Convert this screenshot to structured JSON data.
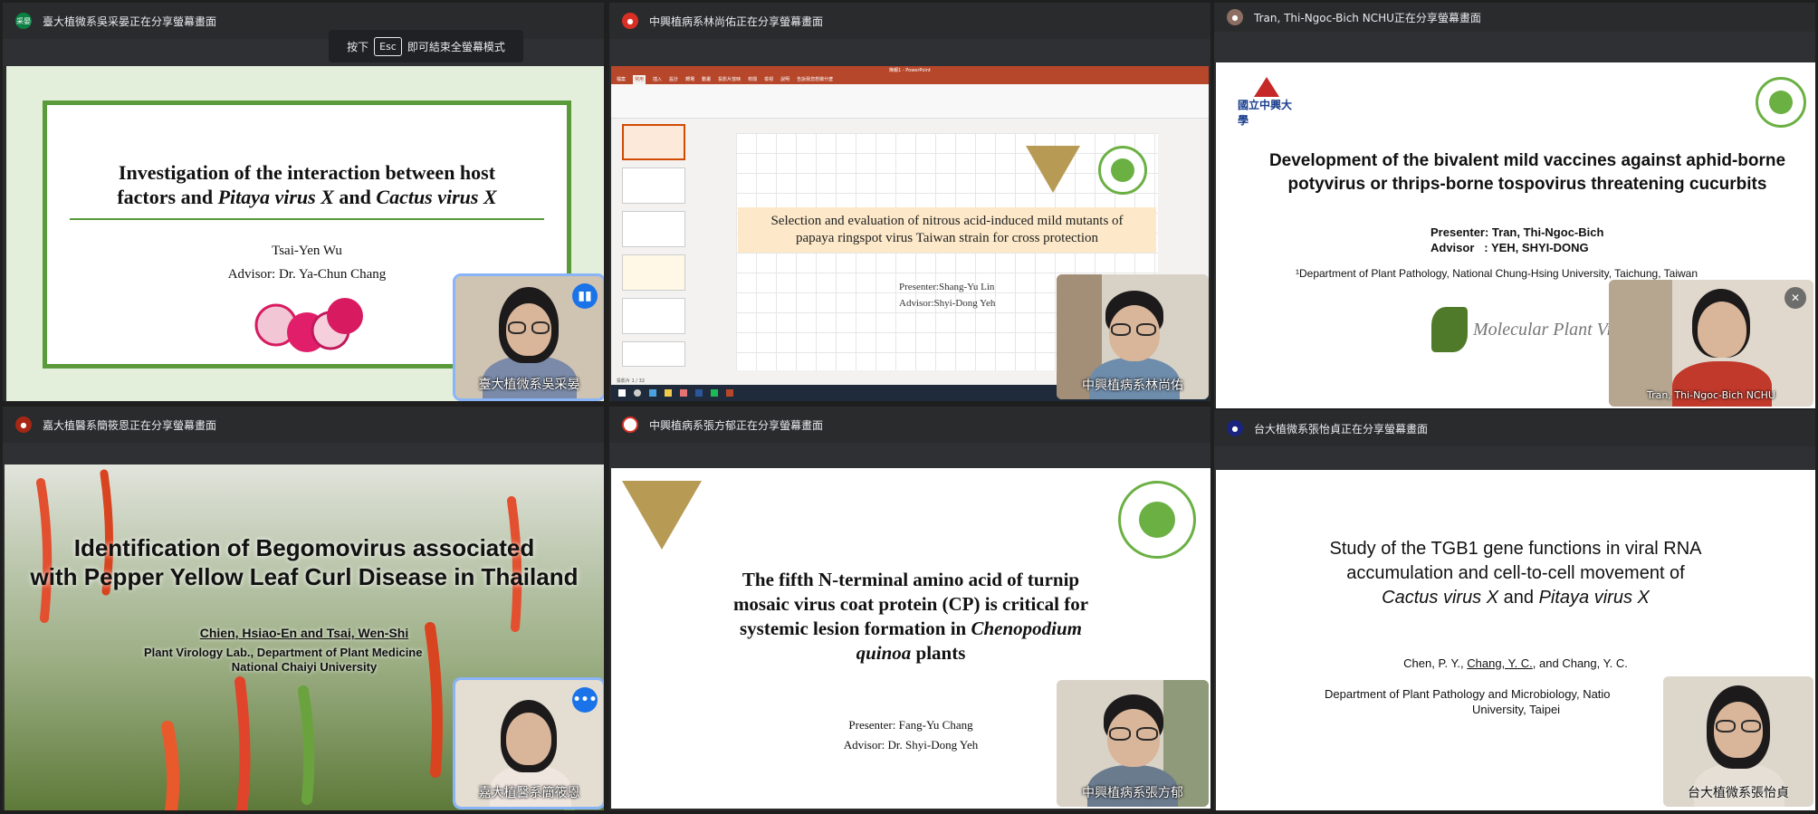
{
  "esc_banner": {
    "press": "按下",
    "key": "Esc",
    "exit": "即可結束全螢幕模式"
  },
  "tiles": [
    {
      "header": "臺大植微系吳采晏正在分享螢幕畫面",
      "avatar_label": "采晏",
      "slide": {
        "title_line1": "Investigation of the interaction between host",
        "title_line2_a": "factors and ",
        "title_line2_b": "Pitaya virus X",
        "title_line2_c": " and ",
        "title_line2_d": "Cactus virus X",
        "author": "Tsai-Yen Wu",
        "advisor": "Advisor: Dr. Ya-Chun Chang"
      },
      "cam_name": "臺大植微系吳采晏"
    },
    {
      "header": "中興植病系林尚佑正在分享螢幕畫面",
      "ppt_title": "簡報1 - PowerPoint",
      "ppt_tabs": [
        "檔案",
        "常用",
        "插入",
        "設計",
        "轉場",
        "動畫",
        "投影片放映",
        "校閱",
        "檢視",
        "說明",
        "告訴我您想做什麼"
      ],
      "slide": {
        "title_line1": "Selection and evaluation of nitrous acid-induced mild mutants of",
        "title_line2": "papaya ringspot virus Taiwan strain for cross protection",
        "presenter": "Presenter:Shang-Yu Lin",
        "advisor": "Advisor:Shyi-Dong Yeh"
      },
      "status_bar": "投影片 1 / 32",
      "cam_name": "中興植病系林尚佑"
    },
    {
      "header": "Tran, Thi-Ngoc-Bich NCHU正在分享螢幕畫面",
      "slide": {
        "org_logo_text": "國立中興大學",
        "title_line1": "Development of the bivalent mild vaccines against aphid-borne",
        "title_line2": "potyvirus or thrips-borne tospovirus threatening cucurbits",
        "presenter": "Presenter: Tran, Thi-Ngoc-Bich",
        "advisor": "Advisor   : YEH, SHYI-DONG",
        "affiliation": "¹Department of Plant Pathology, National Chung-Hsing University, Taichung, Taiwan",
        "lab_logo": "Molecular Plant Virology"
      },
      "cam_name": "Tran, Thi-Ngoc-Bich NCHU"
    },
    {
      "header": "嘉大植醫系簡筱恩正在分享螢幕畫面",
      "slide": {
        "title_line1": "Identification of Begomovirus associated",
        "title_line2": "with Pepper Yellow Leaf Curl Disease in Thailand",
        "authors": "Chien, Hsiao-En and Tsai, Wen-Shi",
        "lab": "Plant Virology Lab., Department of Plant Medicine",
        "univ": "National Chaiyi University"
      },
      "cam_name": "嘉大植醫系簡筱恩"
    },
    {
      "header": "中興植病系張方郁正在分享螢幕畫面",
      "slide": {
        "title_line1": "The fifth N-terminal amino acid of turnip",
        "title_line2": "mosaic virus coat protein (CP) is critical for",
        "title_line3_a": "systemic lesion formation in ",
        "title_line3_b": "Chenopodium",
        "title_line4_a": "quinoa",
        "title_line4_b": " plants",
        "presenter": "Presenter: Fang-Yu Chang",
        "advisor": "Advisor: Dr. Shyi-Dong Yeh"
      },
      "cam_name": "中興植病系張方郁"
    },
    {
      "header": "台大植微系張怡貞正在分享螢幕畫面",
      "slide": {
        "title_line1": "Study of the TGB1 gene functions in viral RNA",
        "title_line2": "accumulation and cell-to-cell movement of",
        "title_line3_a": "Cactus virus X",
        "title_line3_b": " and ",
        "title_line3_c": "Pitaya virus X",
        "authors_a": "Chen, P. Y., ",
        "authors_b": "Chang, Y. C.",
        "authors_c": ", and Chang, Y. C.",
        "dept_line1": "Department of Plant Pathology and Microbiology, Natio",
        "dept_line2": "University, Taipei"
      },
      "cam_name": "台大植微系張怡貞"
    }
  ],
  "colors": {
    "accent": "#1a73e8",
    "green_frame": "#5a9a3a",
    "tile_bg": "#2b2c2e"
  }
}
